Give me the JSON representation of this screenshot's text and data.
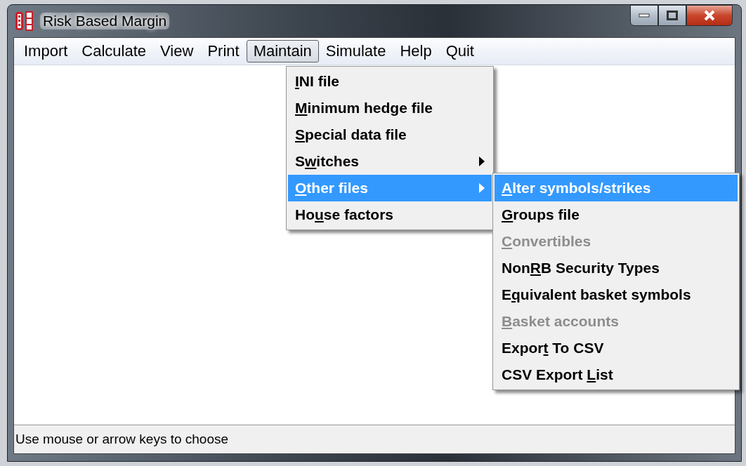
{
  "window": {
    "title": "Risk Based Margin"
  },
  "menu_bar": [
    {
      "label": "Import",
      "selected": false
    },
    {
      "label": "Calculate",
      "selected": false
    },
    {
      "label": "View",
      "selected": false
    },
    {
      "label": "Print",
      "selected": false
    },
    {
      "label": "Maintain",
      "selected": true
    },
    {
      "label": "Simulate",
      "selected": false
    },
    {
      "label": "Help",
      "selected": false
    },
    {
      "label": "Quit",
      "selected": false
    }
  ],
  "maintain_menu": [
    {
      "key": "I",
      "post": "NI file",
      "submenu": false,
      "selected": false,
      "disabled": false
    },
    {
      "key": "M",
      "post": "inimum hedge file",
      "submenu": false,
      "selected": false,
      "disabled": false
    },
    {
      "key": "S",
      "post": "pecial data file",
      "submenu": false,
      "selected": false,
      "disabled": false
    },
    {
      "pre": "S",
      "key": "w",
      "post": "itches",
      "submenu": true,
      "selected": false,
      "disabled": false
    },
    {
      "key": "O",
      "post": "ther files",
      "submenu": true,
      "selected": true,
      "disabled": false
    },
    {
      "pre": "Ho",
      "key": "u",
      "post": "se factors",
      "submenu": false,
      "selected": false,
      "disabled": false
    }
  ],
  "other_files_menu": [
    {
      "key": "A",
      "post": "lter symbols/strikes",
      "submenu": false,
      "selected": true,
      "disabled": false
    },
    {
      "key": "G",
      "post": "roups file",
      "submenu": false,
      "selected": false,
      "disabled": false
    },
    {
      "key": "C",
      "post": "onvertibles",
      "submenu": false,
      "selected": false,
      "disabled": true
    },
    {
      "pre": "Non",
      "key": "R",
      "post": "B Security Types",
      "submenu": false,
      "selected": false,
      "disabled": false
    },
    {
      "pre": "E",
      "key": "q",
      "post": "uivalent basket symbols",
      "submenu": false,
      "selected": false,
      "disabled": false
    },
    {
      "key": "B",
      "post": "asket accounts",
      "submenu": false,
      "selected": false,
      "disabled": true
    },
    {
      "pre": "Expor",
      "key": "t",
      "post": " To CSV",
      "submenu": false,
      "selected": false,
      "disabled": false
    },
    {
      "pre": "CSV Export ",
      "key": "L",
      "post": "ist",
      "submenu": false,
      "selected": false,
      "disabled": false
    }
  ],
  "status_bar": {
    "text": "Use mouse or arrow keys to choose"
  }
}
